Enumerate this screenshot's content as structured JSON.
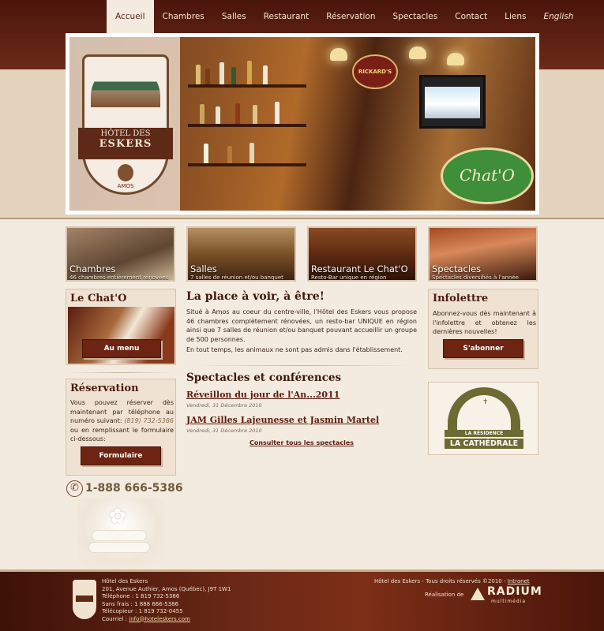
{
  "nav": {
    "items": [
      "Accueil",
      "Chambres",
      "Salles",
      "Restaurant",
      "Réservation",
      "Spectacles",
      "Contact",
      "Liens",
      "English"
    ]
  },
  "banner": {
    "logo_line1": "HÔTEL DES",
    "logo_line2": "ESKERS",
    "logo_city": "AMOS",
    "sign_rickards": "RICKARD'S",
    "chato_sign": "Chat'O"
  },
  "thumbs": [
    {
      "title": "Chambres",
      "subtitle": "46 chambres entièrement rénovées"
    },
    {
      "title": "Salles",
      "subtitle": "7 salles de réunion et/ou banquet"
    },
    {
      "title": "Restaurant Le Chat'O",
      "subtitle": "Resto-Bar unique en région"
    },
    {
      "title": "Spectacles",
      "subtitle": "Spectacles diversifiés à l'année"
    }
  ],
  "chato_box": {
    "title": "Le Chat'O",
    "button": "Au menu"
  },
  "reservation": {
    "title": "Réservation",
    "text_before": "Vous pouvez réserver dès maintenant par téléphone au numéro suivant: ",
    "phone_local": "(819) 732-5386",
    "text_after": " ou en remplissant le formulaire ci-dessous:",
    "button": "Formulaire"
  },
  "tollfree": "1-888 666-5386",
  "main": {
    "title": "La place à voir, à être!",
    "para1": "Situé à Amos au coeur du centre-ville, l'Hôtel des Eskers vous propose 46 chambres complètement rénovées, un resto-bar UNIQUE en région ainsi que 7 salles de réunion et/ou banquet pouvant accueillir un groupe de 500 personnes.",
    "para2": "En tout temps, les animaux ne sont pas admis dans l'établissement.",
    "shows_title": "Spectacles et conférences",
    "shows": [
      {
        "title": "Réveillon du jour de l'An...2011",
        "date": "Vendredi, 31 Décembre 2010"
      },
      {
        "title": "JAM Gilles Lajeunesse et Jasmin Martel",
        "date": "Vendredi, 31 Décembre 2010"
      }
    ],
    "all_shows_link": "Consulter tous les spectacles"
  },
  "newsletter": {
    "title": "Infolettre",
    "text": "Abonnez-vous dès maintenant à l'infolettre et obtenez les dernières nouvelles!",
    "button": "S'abonner"
  },
  "residence": {
    "line1": "LA RÉSIDENCE",
    "line2": "LA CATHÉDRALE"
  },
  "footer": {
    "name": "Hôtel des Eskers",
    "address": "201, Avenue Authier, Amos (Québec), J9T 1W1",
    "phone": "Téléphone : 1 819 732-5386",
    "tollfree": "Sans frais : 1 888 666-5386",
    "fax": "Télécopieur : 1 819 732-0455",
    "email_label": "Courriel : ",
    "email": "info@hoteleskers.com",
    "copyright": "Hôtel des Eskers - Tous droits réservés ©2010 - ",
    "intranet": "Intranet",
    "credit": "Réalisation de",
    "radium": "RADIUM",
    "radium_sub": "multimédia"
  }
}
